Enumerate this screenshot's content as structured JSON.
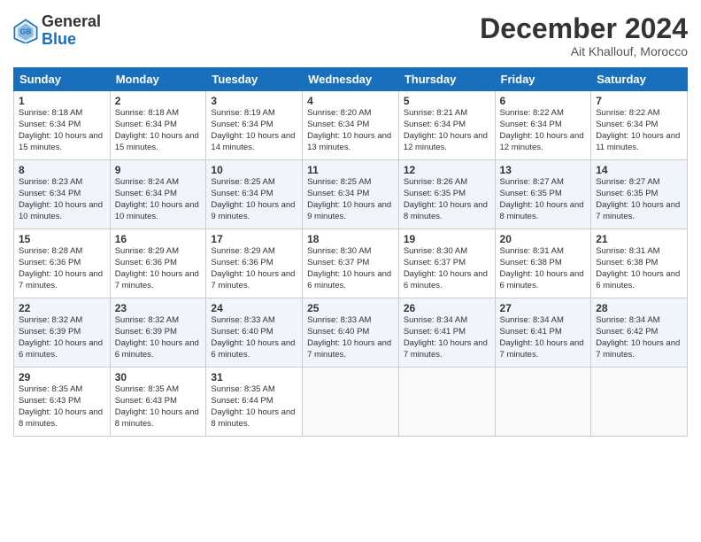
{
  "logo": {
    "general": "General",
    "blue": "Blue"
  },
  "title": "December 2024",
  "location": "Ait Khallouf, Morocco",
  "days_header": [
    "Sunday",
    "Monday",
    "Tuesday",
    "Wednesday",
    "Thursday",
    "Friday",
    "Saturday"
  ],
  "weeks": [
    [
      {
        "num": "1",
        "sunrise": "8:18 AM",
        "sunset": "6:34 PM",
        "daylight": "10 hours and 15 minutes."
      },
      {
        "num": "2",
        "sunrise": "8:18 AM",
        "sunset": "6:34 PM",
        "daylight": "10 hours and 15 minutes."
      },
      {
        "num": "3",
        "sunrise": "8:19 AM",
        "sunset": "6:34 PM",
        "daylight": "10 hours and 14 minutes."
      },
      {
        "num": "4",
        "sunrise": "8:20 AM",
        "sunset": "6:34 PM",
        "daylight": "10 hours and 13 minutes."
      },
      {
        "num": "5",
        "sunrise": "8:21 AM",
        "sunset": "6:34 PM",
        "daylight": "10 hours and 12 minutes."
      },
      {
        "num": "6",
        "sunrise": "8:22 AM",
        "sunset": "6:34 PM",
        "daylight": "10 hours and 12 minutes."
      },
      {
        "num": "7",
        "sunrise": "8:22 AM",
        "sunset": "6:34 PM",
        "daylight": "10 hours and 11 minutes."
      }
    ],
    [
      {
        "num": "8",
        "sunrise": "8:23 AM",
        "sunset": "6:34 PM",
        "daylight": "10 hours and 10 minutes."
      },
      {
        "num": "9",
        "sunrise": "8:24 AM",
        "sunset": "6:34 PM",
        "daylight": "10 hours and 10 minutes."
      },
      {
        "num": "10",
        "sunrise": "8:25 AM",
        "sunset": "6:34 PM",
        "daylight": "10 hours and 9 minutes."
      },
      {
        "num": "11",
        "sunrise": "8:25 AM",
        "sunset": "6:34 PM",
        "daylight": "10 hours and 9 minutes."
      },
      {
        "num": "12",
        "sunrise": "8:26 AM",
        "sunset": "6:35 PM",
        "daylight": "10 hours and 8 minutes."
      },
      {
        "num": "13",
        "sunrise": "8:27 AM",
        "sunset": "6:35 PM",
        "daylight": "10 hours and 8 minutes."
      },
      {
        "num": "14",
        "sunrise": "8:27 AM",
        "sunset": "6:35 PM",
        "daylight": "10 hours and 7 minutes."
      }
    ],
    [
      {
        "num": "15",
        "sunrise": "8:28 AM",
        "sunset": "6:36 PM",
        "daylight": "10 hours and 7 minutes."
      },
      {
        "num": "16",
        "sunrise": "8:29 AM",
        "sunset": "6:36 PM",
        "daylight": "10 hours and 7 minutes."
      },
      {
        "num": "17",
        "sunrise": "8:29 AM",
        "sunset": "6:36 PM",
        "daylight": "10 hours and 7 minutes."
      },
      {
        "num": "18",
        "sunrise": "8:30 AM",
        "sunset": "6:37 PM",
        "daylight": "10 hours and 6 minutes."
      },
      {
        "num": "19",
        "sunrise": "8:30 AM",
        "sunset": "6:37 PM",
        "daylight": "10 hours and 6 minutes."
      },
      {
        "num": "20",
        "sunrise": "8:31 AM",
        "sunset": "6:38 PM",
        "daylight": "10 hours and 6 minutes."
      },
      {
        "num": "21",
        "sunrise": "8:31 AM",
        "sunset": "6:38 PM",
        "daylight": "10 hours and 6 minutes."
      }
    ],
    [
      {
        "num": "22",
        "sunrise": "8:32 AM",
        "sunset": "6:39 PM",
        "daylight": "10 hours and 6 minutes."
      },
      {
        "num": "23",
        "sunrise": "8:32 AM",
        "sunset": "6:39 PM",
        "daylight": "10 hours and 6 minutes."
      },
      {
        "num": "24",
        "sunrise": "8:33 AM",
        "sunset": "6:40 PM",
        "daylight": "10 hours and 6 minutes."
      },
      {
        "num": "25",
        "sunrise": "8:33 AM",
        "sunset": "6:40 PM",
        "daylight": "10 hours and 7 minutes."
      },
      {
        "num": "26",
        "sunrise": "8:34 AM",
        "sunset": "6:41 PM",
        "daylight": "10 hours and 7 minutes."
      },
      {
        "num": "27",
        "sunrise": "8:34 AM",
        "sunset": "6:41 PM",
        "daylight": "10 hours and 7 minutes."
      },
      {
        "num": "28",
        "sunrise": "8:34 AM",
        "sunset": "6:42 PM",
        "daylight": "10 hours and 7 minutes."
      }
    ],
    [
      {
        "num": "29",
        "sunrise": "8:35 AM",
        "sunset": "6:43 PM",
        "daylight": "10 hours and 8 minutes."
      },
      {
        "num": "30",
        "sunrise": "8:35 AM",
        "sunset": "6:43 PM",
        "daylight": "10 hours and 8 minutes."
      },
      {
        "num": "31",
        "sunrise": "8:35 AM",
        "sunset": "6:44 PM",
        "daylight": "10 hours and 8 minutes."
      },
      null,
      null,
      null,
      null
    ]
  ]
}
